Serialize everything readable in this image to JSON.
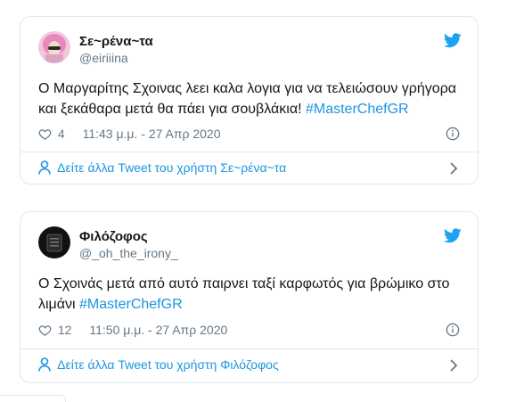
{
  "tweets": [
    {
      "display_name": "Σε~ρένα~τα",
      "handle": "@eiriiina",
      "text": "Ο Μαργαρίτης Σχοινας λεει καλα λογια για να τελειώσουν γρήγορα και ξεκάθαρα μετά θα πάει για σουβλάκια! ",
      "hashtag": "#MasterChefGR",
      "likes": "4",
      "timestamp": "11:43 μ.μ. - 27 Απρ 2020",
      "more_link": "Δείτε άλλα Tweet του χρήστη Σε~ρένα~τα"
    },
    {
      "display_name": "Φιλόζοφος",
      "handle": "@_oh_the_irony_",
      "text": "Ο Σχοινάς μετά από αυτό παιρνει ταξί καρφωτός για βρώμικο στο λιμάνι ",
      "hashtag": "#MasterChefGR",
      "likes": "12",
      "timestamp": "11:50 μ.μ. - 27 Απρ 2020",
      "more_link": "Δείτε άλλα Tweet του χρήστη Φιλόζοφος"
    }
  ],
  "colors": {
    "accent": "#1b95e0",
    "twitter_blue": "#1da1f2",
    "muted": "#657786",
    "border": "#e1e8ed"
  },
  "icons": [
    "twitter-bird-icon",
    "heart-icon",
    "info-icon",
    "person-icon",
    "chevron-right-icon"
  ]
}
